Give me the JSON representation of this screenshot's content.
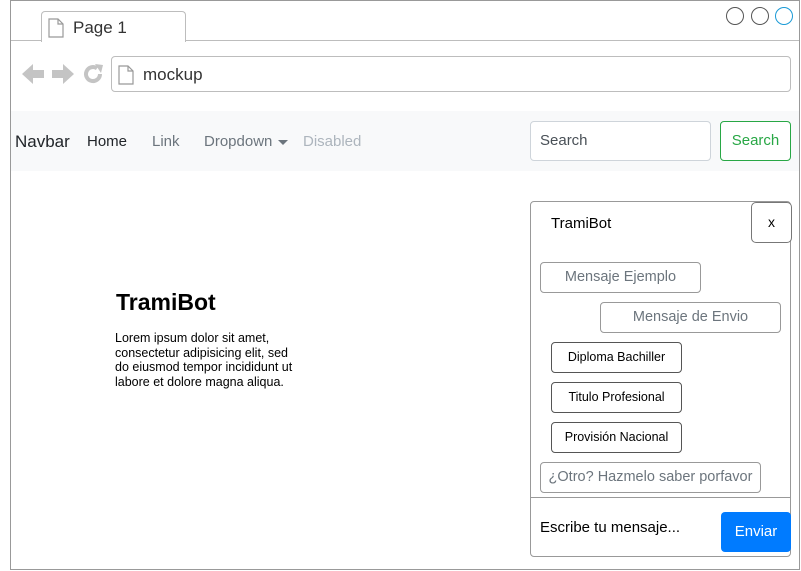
{
  "browser": {
    "tab": {
      "title": "Page 1",
      "icon": "page-icon"
    },
    "url": "mockup",
    "window_controls": [
      "minimize-circle",
      "maximize-circle",
      "close-circle"
    ]
  },
  "navbar": {
    "brand": "Navbar",
    "links": [
      {
        "label": "Home",
        "state": "active"
      },
      {
        "label": "Link",
        "state": "normal"
      },
      {
        "label": "Dropdown",
        "state": "normal"
      },
      {
        "label": "Disabled",
        "state": "disabled"
      }
    ],
    "search": {
      "placeholder": "Search",
      "button_label": "Search"
    }
  },
  "hero": {
    "title": "TramiBot",
    "text": "Lorem ipsum dolor sit amet, consectetur adipisicing elit, sed do eiusmod tempor incididunt ut labore et dolore magna aliqua."
  },
  "chat": {
    "title": "TramiBot",
    "close_label": "x",
    "messages": {
      "example": "Mensaje Ejemplo",
      "sent": "Mensaje de Envio",
      "other": "¿Otro? Hazmelo saber porfavor"
    },
    "quick_replies": [
      "Diploma Bachiller",
      "Titulo Profesional",
      "Provisión Nacional"
    ],
    "input_placeholder": "Escribe tu mensaje...",
    "send_label": "Enviar"
  },
  "colors": {
    "accent_blue": "#007bff",
    "success_green": "#28a745",
    "navbar_bg": "#f8f9fa",
    "control_active_ring": "#1a9ad6"
  }
}
